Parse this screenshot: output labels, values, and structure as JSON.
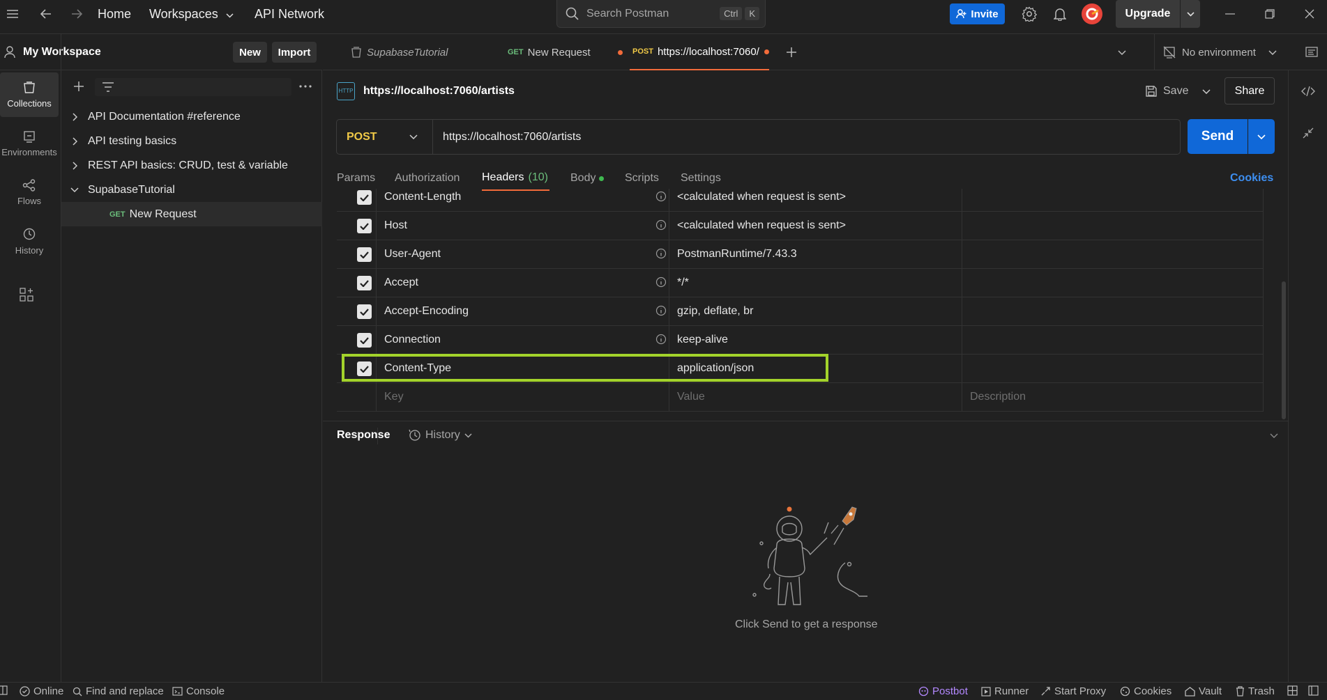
{
  "titlebar": {
    "home": "Home",
    "workspaces": "Workspaces",
    "api_network": "API Network",
    "search_placeholder": "Search Postman",
    "search_kbd1": "Ctrl",
    "search_kbd2": "K",
    "invite": "Invite",
    "upgrade": "Upgrade"
  },
  "workspace": {
    "name": "My Workspace",
    "new_label": "New",
    "import_label": "Import"
  },
  "rail": {
    "collections": "Collections",
    "environments": "Environments",
    "flows": "Flows",
    "history": "History"
  },
  "sidebar": {
    "items": [
      {
        "label": "API Documentation #reference",
        "expanded": false
      },
      {
        "label": "API testing basics",
        "expanded": false
      },
      {
        "label": "REST API basics: CRUD, test & variable",
        "expanded": false
      },
      {
        "label": "SupabaseTutorial",
        "expanded": true
      }
    ],
    "child": {
      "method": "GET",
      "label": "New Request"
    }
  },
  "tabs": [
    {
      "label": "SupabaseTutorial",
      "method": ""
    },
    {
      "label": "New Request",
      "method": "GET"
    },
    {
      "label": "https://localhost:7060/",
      "method": "POST"
    }
  ],
  "environment": "No environment",
  "request": {
    "title": "https://localhost:7060/artists",
    "method": "POST",
    "url": "https://localhost:7060/artists",
    "save": "Save",
    "share": "Share",
    "send": "Send",
    "http_badge": "HTTP",
    "tabs": {
      "params": "Params",
      "authorization": "Authorization",
      "headers": "Headers",
      "headers_count": "(10)",
      "body": "Body",
      "scripts": "Scripts",
      "settings": "Settings",
      "cookies": "Cookies"
    }
  },
  "headers": [
    {
      "key": "Content-Length",
      "value": "<calculated when request is sent>",
      "info": true
    },
    {
      "key": "Host",
      "value": "<calculated when request is sent>",
      "info": true
    },
    {
      "key": "User-Agent",
      "value": "PostmanRuntime/7.43.3",
      "info": true
    },
    {
      "key": "Accept",
      "value": "*/*",
      "info": true
    },
    {
      "key": "Accept-Encoding",
      "value": "gzip, deflate, br",
      "info": true
    },
    {
      "key": "Connection",
      "value": "keep-alive",
      "info": true
    },
    {
      "key": "Content-Type",
      "value": "application/json",
      "info": false
    }
  ],
  "headers_placeholder": {
    "key": "Key",
    "value": "Value",
    "description": "Description"
  },
  "response": {
    "label": "Response",
    "history": "History",
    "empty": "Click Send to get a response"
  },
  "statusbar": {
    "online": "Online",
    "find_replace": "Find and replace",
    "console": "Console",
    "postbot": "Postbot",
    "runner": "Runner",
    "start_proxy": "Start Proxy",
    "cookies": "Cookies",
    "vault": "Vault",
    "trash": "Trash"
  },
  "colors": {
    "accent": "#f26b3a",
    "primary": "#1068d8",
    "highlight": "#a3d32b",
    "post": "#f0c947",
    "get": "#6bbd7b"
  }
}
